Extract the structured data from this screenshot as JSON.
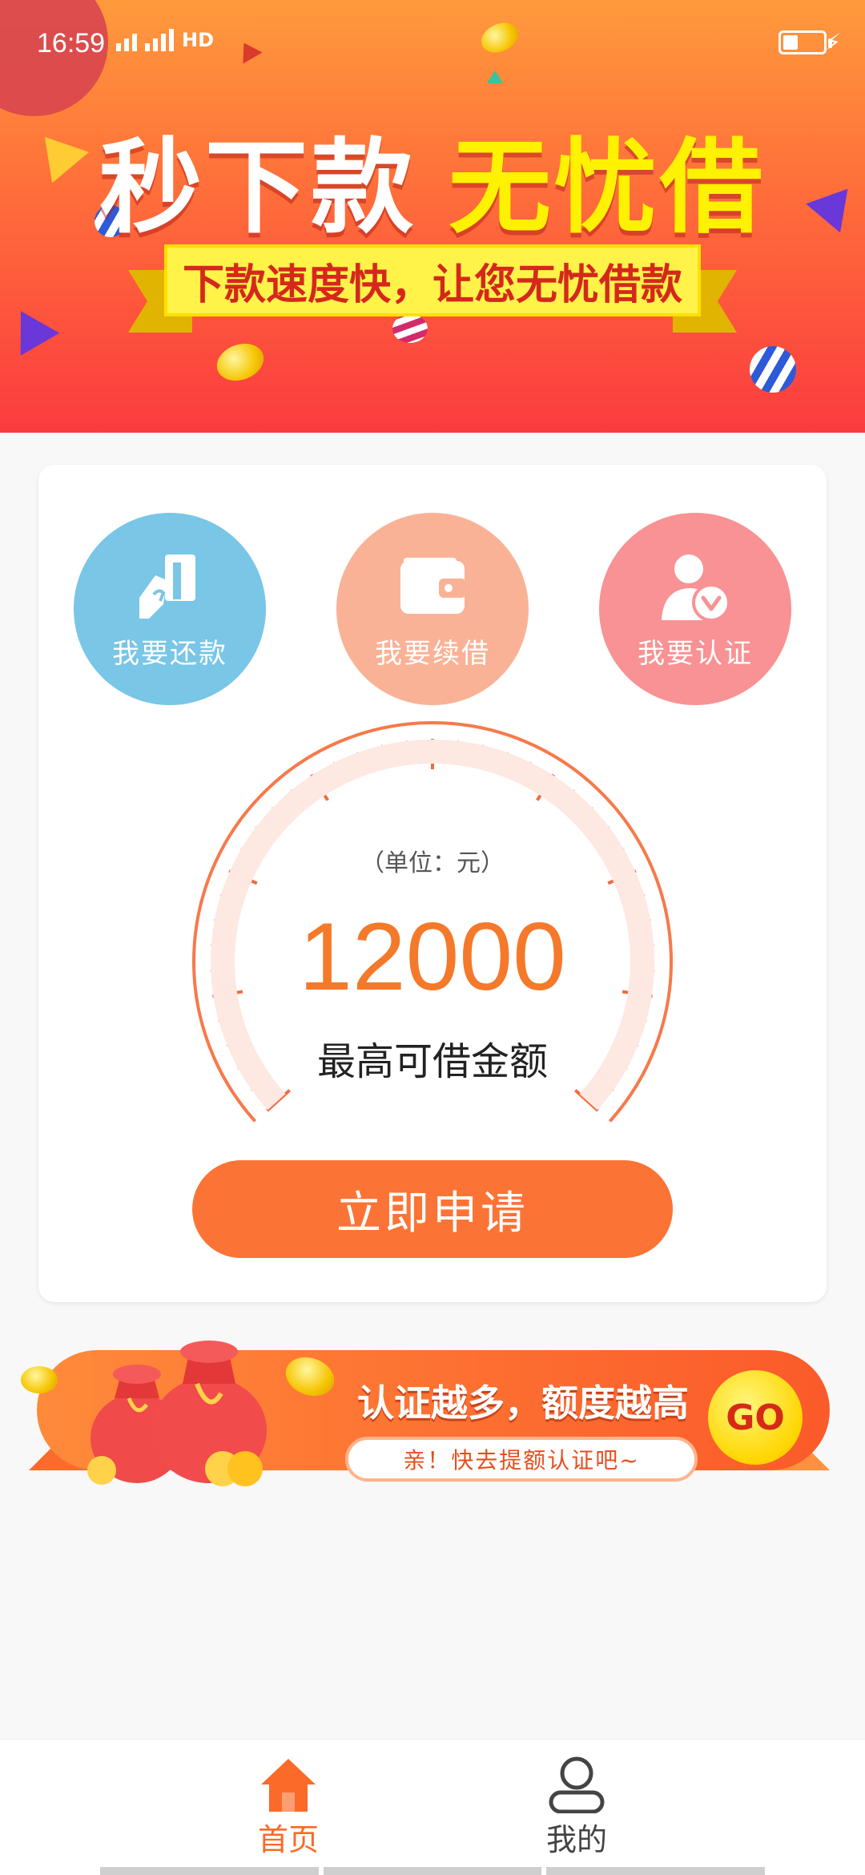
{
  "status_bar": {
    "time": "16:59",
    "network_1": "4G",
    "network_2": "4G",
    "hd": "HD"
  },
  "banner": {
    "title_left": "秒下款",
    "title_right": "无忧借",
    "subtitle": "下款速度快，让您无忧借款"
  },
  "features": [
    {
      "label": "我要还款",
      "icon": "repay-card-icon",
      "color": "#79c6e6"
    },
    {
      "label": "我要续借",
      "icon": "wallet-icon",
      "color": "#fab296"
    },
    {
      "label": "我要认证",
      "icon": "user-verify-icon",
      "color": "#f99294"
    }
  ],
  "gauge": {
    "unit": "（单位：元）",
    "amount": "12000",
    "caption": "最高可借金额"
  },
  "apply_button": "立即申请",
  "promo": {
    "title": "认证越多，额度越高",
    "subtitle": "亲！快去提额认证吧~",
    "go": "GO"
  },
  "nav": [
    {
      "label": "首页",
      "icon": "home-icon",
      "active": true
    },
    {
      "label": "我的",
      "icon": "user-icon",
      "active": false
    }
  ],
  "colors": {
    "accent": "#fb7435",
    "active_nav": "#fb6a28",
    "gauge_amount": "#f5792a"
  }
}
